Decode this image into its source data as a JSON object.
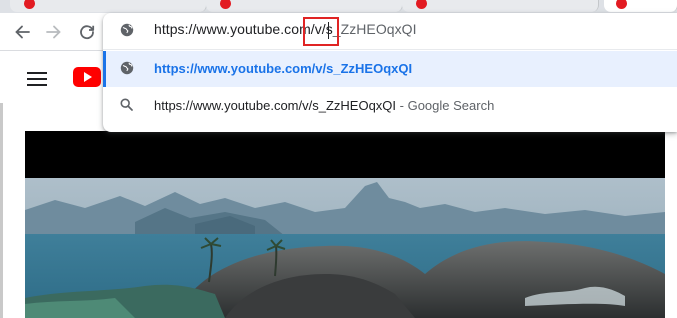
{
  "browser": {
    "tabs": [
      {
        "name": "tab-1"
      },
      {
        "name": "tab-2"
      },
      {
        "name": "tab-3"
      },
      {
        "name": "tab-4-active"
      }
    ],
    "nav": {
      "back_icon": "arrow-left-icon",
      "forward_icon": "arrow-right-icon",
      "reload_icon": "reload-icon"
    }
  },
  "omnibox": {
    "input_prefix": "https://www.youtube.co",
    "input_highlighted": "m/v/s",
    "input_suffix": "_ZzHEOqxQI",
    "suggestions": [
      {
        "icon": "globe-icon",
        "text": "https://www.youtube.com/v/s_ZzHEOqxQI"
      },
      {
        "icon": "search-icon",
        "text": "https://www.youtube.com/v/s_ZzHEOqxQI",
        "separator": " - ",
        "tail": "Google Search"
      }
    ]
  },
  "youtube": {
    "logo_color": "#ff0000",
    "menu_icon": "hamburger-menu-icon"
  },
  "colors": {
    "highlight_box": "#e02424",
    "selected_suggestion_bg": "#e8f0fe",
    "link_blue": "#1a73e8"
  }
}
